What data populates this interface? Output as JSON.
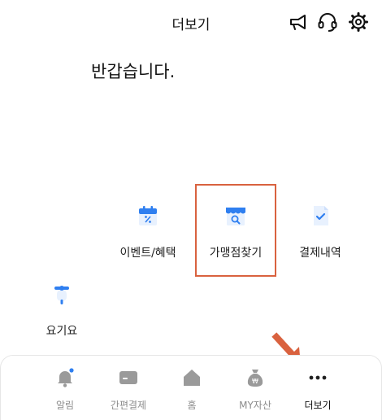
{
  "header": {
    "title": "더보기"
  },
  "greeting": "반갑습니다.",
  "services": [
    {
      "label": "이벤트/혜택",
      "icon": "calendar-percent-icon"
    },
    {
      "label": "가맹점찾기",
      "icon": "store-search-icon"
    },
    {
      "label": "결제내역",
      "icon": "receipt-check-icon"
    },
    {
      "label": "요기요",
      "icon": "scooter-icon"
    }
  ],
  "tabs": [
    {
      "label": "알림",
      "icon": "bell-icon"
    },
    {
      "label": "간편결제",
      "icon": "card-icon"
    },
    {
      "label": "홈",
      "icon": "home-icon"
    },
    {
      "label": "MY자산",
      "icon": "money-bag-icon"
    },
    {
      "label": "더보기",
      "icon": "more-dots-icon"
    }
  ],
  "colors": {
    "accent_blue": "#2f7ff0",
    "highlight": "#d9623f",
    "inactive_tab": "#8c8c8c"
  }
}
